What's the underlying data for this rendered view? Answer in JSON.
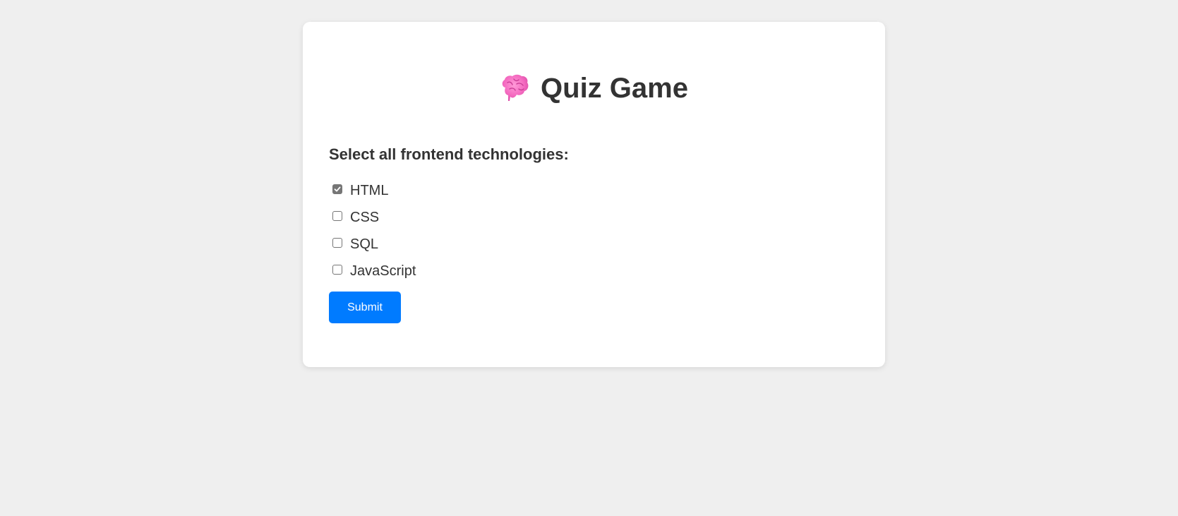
{
  "quiz": {
    "title": "Quiz Game",
    "title_icon": "brain-icon",
    "question": "Select all frontend technologies:",
    "options": [
      {
        "label": "HTML",
        "checked": true
      },
      {
        "label": "CSS",
        "checked": false
      },
      {
        "label": "SQL",
        "checked": false
      },
      {
        "label": "JavaScript",
        "checked": false
      }
    ],
    "submit_label": "Submit"
  },
  "colors": {
    "background": "#efefef",
    "card": "#ffffff",
    "text": "#333333",
    "accent": "#007bff",
    "checkbox_checked": "#767676",
    "brain_icon": "#f46ac0"
  }
}
